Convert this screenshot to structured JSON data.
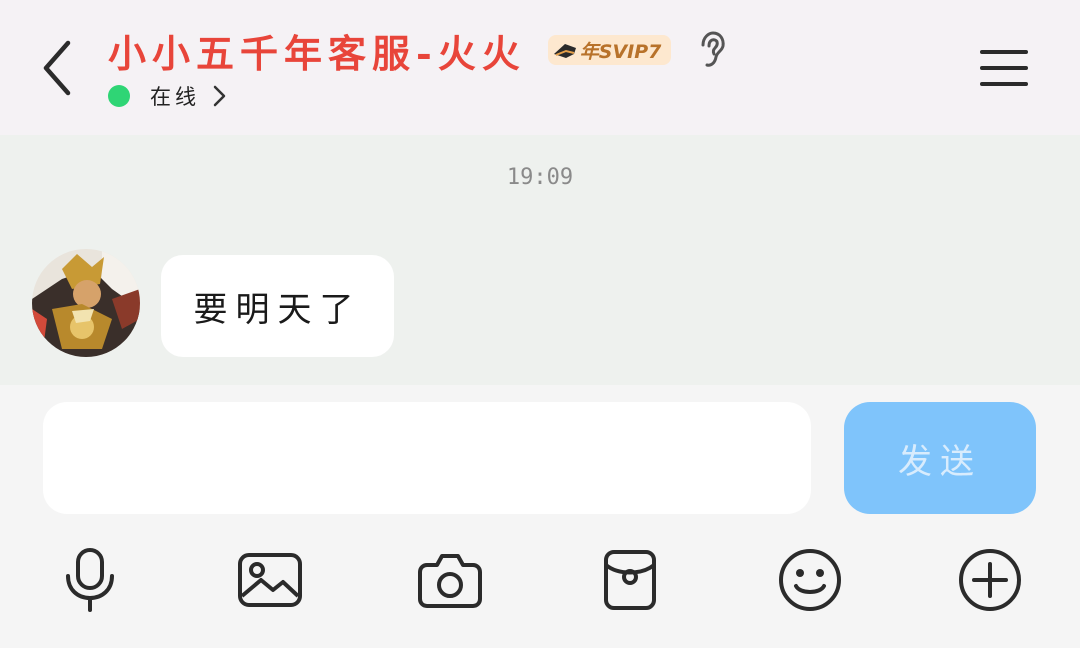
{
  "header": {
    "contact_name": "小小五千年客服-火火",
    "vip_badge": "年SVIP7",
    "status": "在线"
  },
  "chat": {
    "timestamp": "19:09",
    "messages": [
      {
        "sender": "contact",
        "text": "要明天了"
      }
    ]
  },
  "composer": {
    "input_value": "",
    "send_label": "发送"
  },
  "toolbar": {
    "icons": [
      "microphone-icon",
      "image-icon",
      "camera-icon",
      "red-packet-icon",
      "emoji-icon",
      "plus-icon"
    ]
  },
  "colors": {
    "contact_name": "#e8453a",
    "online": "#2fd575",
    "send_button": "#7fc4fb",
    "chat_background": "#eef1ee"
  }
}
